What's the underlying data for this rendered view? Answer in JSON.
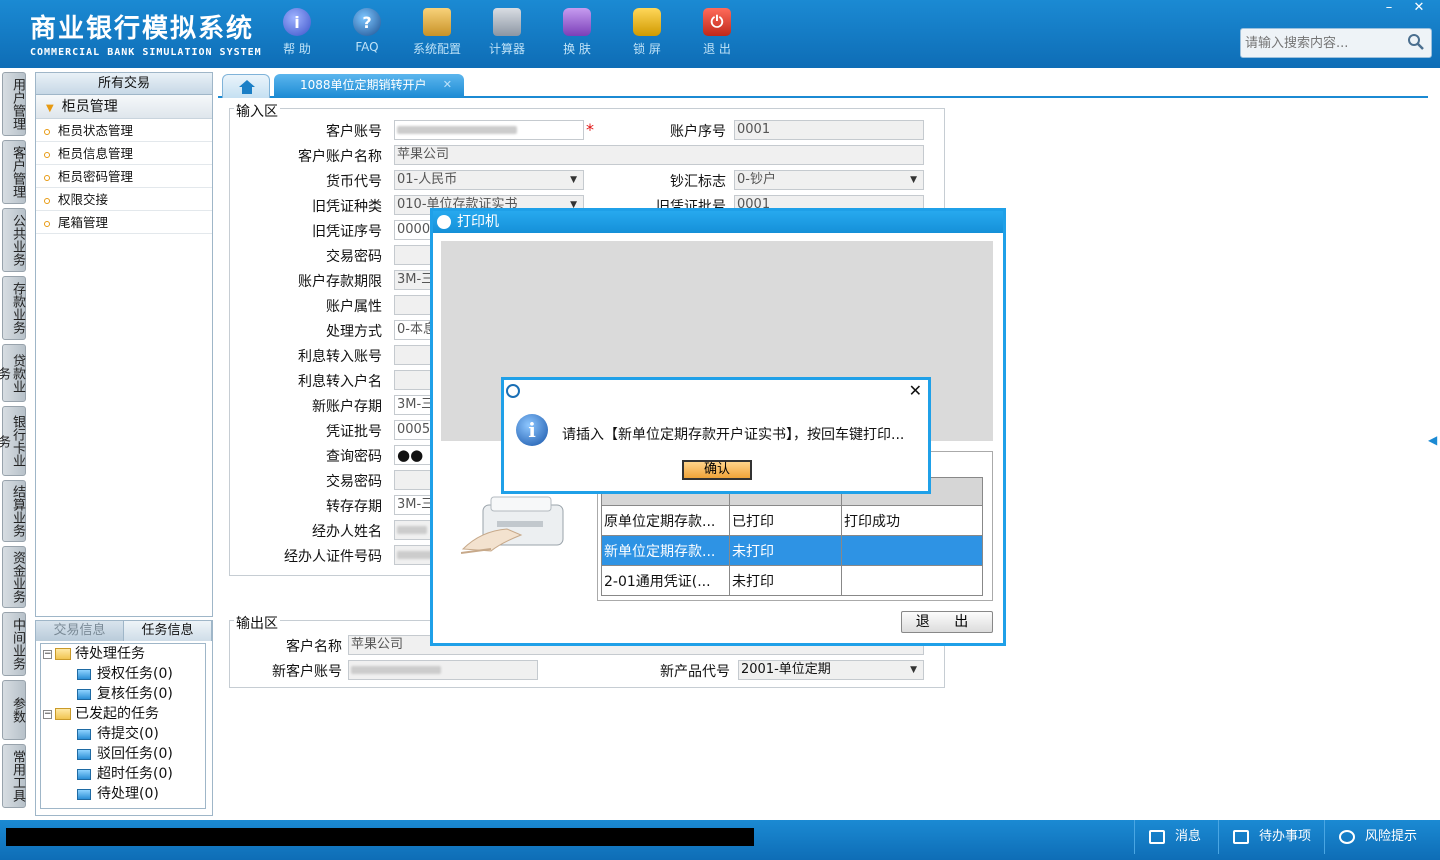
{
  "header": {
    "title_cn": "商业银行模拟系统",
    "title_en": "COMMERCIAL BANK SIMULATION SYSTEM",
    "toolbar": [
      {
        "label": "帮 助",
        "icon": "help-icon",
        "glyph": "i"
      },
      {
        "label": "FAQ",
        "icon": "faq-icon",
        "glyph": "?"
      },
      {
        "label": "系统配置",
        "icon": "config-icon",
        "glyph": ""
      },
      {
        "label": "计算器",
        "icon": "calculator-icon",
        "glyph": ""
      },
      {
        "label": "换 肤",
        "icon": "skin-icon",
        "glyph": ""
      },
      {
        "label": "锁 屏",
        "icon": "lock-icon",
        "glyph": ""
      },
      {
        "label": "退 出",
        "icon": "exit-icon",
        "glyph": "⏻"
      }
    ],
    "search_placeholder": "请输入搜索内容...",
    "window_controls": {
      "minimize": "–",
      "close": "✕"
    }
  },
  "vertical_tabs": [
    "用户管理",
    "客户管理",
    "公共业务",
    "存款业务",
    "贷款业务",
    "银行卡业务",
    "结算业务",
    "资金业务",
    "中间业务",
    "参数",
    "常用工具"
  ],
  "nav": {
    "header": "所有交易",
    "group": "柜员管理",
    "items": [
      "柜员状态管理",
      "柜员信息管理",
      "柜员密码管理",
      "权限交接",
      "尾箱管理"
    ]
  },
  "tasks": {
    "tabs": [
      "交易信息",
      "任务信息"
    ],
    "tree": [
      {
        "label": "待处理任务",
        "children": [
          "授权任务(0)",
          "复核任务(0)"
        ]
      },
      {
        "label": "已发起的任务",
        "children": [
          "待提交(0)",
          "驳回任务(0)",
          "超时任务(0)",
          "待处理(0)"
        ]
      }
    ]
  },
  "tabs": {
    "active": "1088单位定期销转开户",
    "close": "✕"
  },
  "input_area": {
    "legend": "输入区",
    "fields": {
      "customer_account": {
        "label": "客户账号"
      },
      "account_seq": {
        "label": "账户序号",
        "value": "0001"
      },
      "customer_account_name": {
        "label": "客户账户名称",
        "value": "苹果公司"
      },
      "currency": {
        "label": "货币代号",
        "value": "01-人民币"
      },
      "cash_flag": {
        "label": "钞汇标志",
        "value": "0-钞户"
      },
      "old_voucher_type": {
        "label": "旧凭证种类",
        "value": "010-单位存款证实书"
      },
      "old_voucher_batch": {
        "label": "旧凭证批号",
        "value": "0001"
      },
      "old_voucher_no": {
        "label": "旧凭证序号",
        "value": "00000"
      },
      "trade_password": {
        "label": "交易密码"
      },
      "deposit_term": {
        "label": "账户存款期限",
        "value": "3M-三"
      },
      "account_attr": {
        "label": "账户属性"
      },
      "process_method": {
        "label": "处理方式",
        "value": "0-本息"
      },
      "interest_account": {
        "label": "利息转入账号"
      },
      "interest_name": {
        "label": "利息转入户名"
      },
      "new_term": {
        "label": "新账户存期",
        "value": "3M-三"
      },
      "voucher_batch": {
        "label": "凭证批号",
        "value": "0005"
      },
      "query_password": {
        "label": "查询密码",
        "value": "●●"
      },
      "trade_password2": {
        "label": "交易密码"
      },
      "rollover_term": {
        "label": "转存存期",
        "value": "3M-三"
      },
      "agent_name": {
        "label": "经办人姓名"
      },
      "agent_id": {
        "label": "经办人证件号码"
      }
    }
  },
  "output_area": {
    "legend": "输出区",
    "customer_name": {
      "label": "客户名称",
      "value": "苹果公司"
    },
    "new_account": {
      "label": "新客户账号"
    },
    "product_code": {
      "label": "新产品代号",
      "value": "2001-单位定期"
    }
  },
  "printer_dialog": {
    "title": "打印机",
    "rows": [
      {
        "name": "原单位定期存款...",
        "status": "已打印",
        "result": "打印成功"
      },
      {
        "name": "新单位定期存款...",
        "status": "未打印",
        "result": ""
      },
      {
        "name": "2-01通用凭证(...",
        "status": "未打印",
        "result": ""
      }
    ],
    "exit_label": "退 出"
  },
  "message_box": {
    "text": "请插入【新单位定期存款开户证实书】，按回车键打印...",
    "ok_label": "确认",
    "close": "✕",
    "icon": "info-icon"
  },
  "statusbar": {
    "messages": "消息",
    "todo": "待办事项",
    "risk": "风险提示"
  },
  "colors": {
    "header_blue": "#1b8ad3",
    "dialog_border": "#1fa0e8",
    "selected_row": "#2e93e4",
    "required": "#e01010"
  }
}
